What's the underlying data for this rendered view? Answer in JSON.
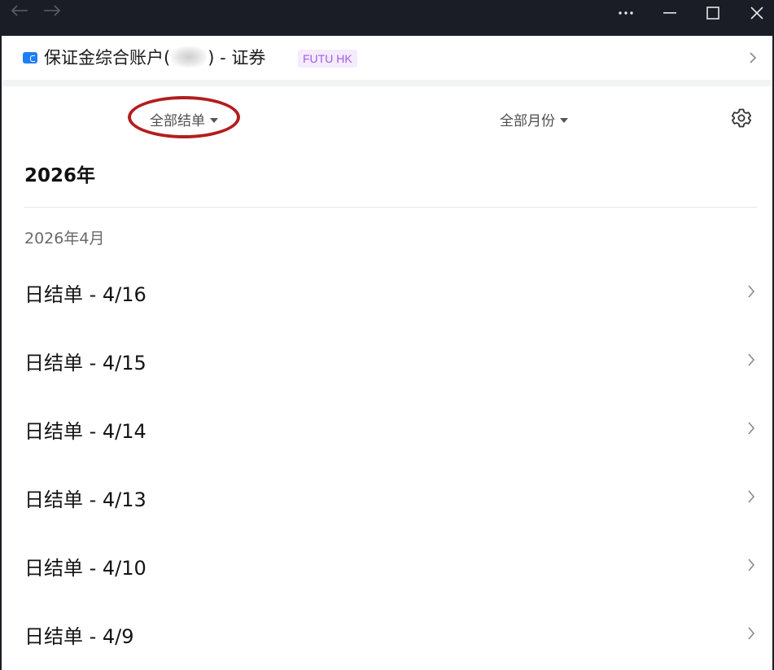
{
  "window": {
    "back_icon": "arrow-left-icon",
    "forward_icon": "arrow-right-icon",
    "more_icon": "more-dots-icon",
    "minimize_icon": "minimize-icon",
    "maximize_icon": "maximize-icon",
    "close_icon": "close-icon"
  },
  "account": {
    "title_prefix": "保证金综合账户(",
    "masked_id": "5",
    "title_suffix": ") - 证券",
    "broker_badge": "FUTU HK",
    "icon": "card-icon",
    "badge_color": "#a45be9",
    "badge_bg": "#f4ecfd",
    "icon_color": "#1f7ef5"
  },
  "filters": {
    "statement_type": "全部结单",
    "month": "全部月份",
    "settings_icon": "gear-icon",
    "highlight_color": "#b21e1e"
  },
  "year_heading": "2026年",
  "month_heading": "2026年4月",
  "statements": [
    {
      "label": "日结单 - 4/16"
    },
    {
      "label": "日结单 - 4/15"
    },
    {
      "label": "日结单 - 4/14"
    },
    {
      "label": "日结单 - 4/13"
    },
    {
      "label": "日结单 - 4/10"
    },
    {
      "label": "日结单 - 4/9"
    }
  ]
}
